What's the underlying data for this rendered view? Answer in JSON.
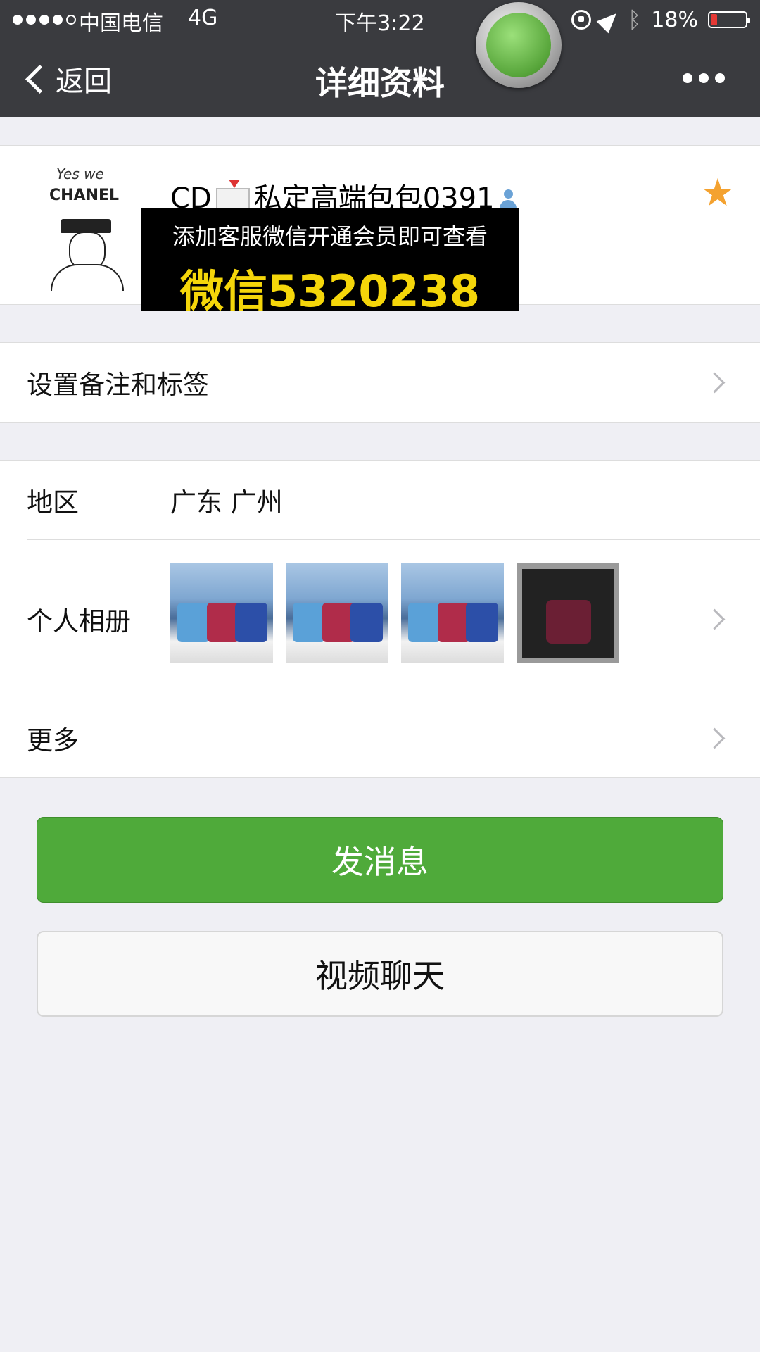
{
  "status_bar": {
    "carrier": "中国电信",
    "network": "4G",
    "time": "下午3:22",
    "battery_percent": "18%",
    "battery_level": 0.18,
    "battery_color": "#e53935"
  },
  "nav": {
    "back_label": "返回",
    "title": "详细资料"
  },
  "profile": {
    "avatar_text_top": "Yes we",
    "avatar_text_brand": "CHANEL",
    "name_prefix": "CD",
    "name_suffix": "私定高端包包0391",
    "starred": true
  },
  "overlay_ad": {
    "line1": "添加客服微信开通会员即可查看",
    "line2": "微信5320238"
  },
  "cells": {
    "remark_label": "设置备注和标签",
    "region_label": "地区",
    "region_value": "广东 广州",
    "album_label": "个人相册",
    "more_label": "更多"
  },
  "buttons": {
    "send_message": "发消息",
    "video_call": "视频聊天"
  },
  "colors": {
    "nav_bg": "#3a3b3f",
    "primary_green": "#4faa3a",
    "star": "#f4a230",
    "ad_yellow": "#f5d60a"
  }
}
